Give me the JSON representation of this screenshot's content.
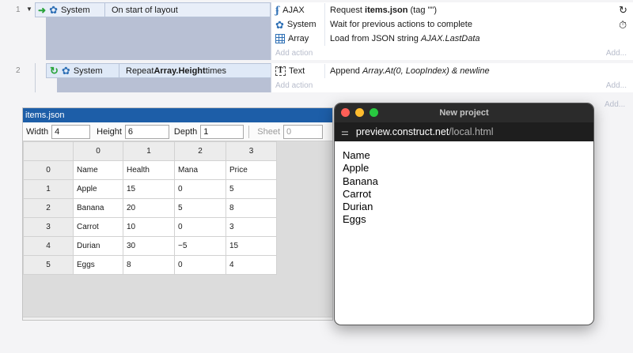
{
  "events": [
    {
      "number": "1",
      "condition": {
        "object": "System",
        "text": "On start of layout"
      },
      "actions": [
        {
          "object": "AJAX",
          "icon": "ajax-icon",
          "text_before": "Request ",
          "bold": "items.json",
          "text_after": " (tag \"\")",
          "italic": ""
        },
        {
          "object": "System",
          "icon": "gear-icon",
          "text_before": "Wait for previous actions to complete",
          "bold": "",
          "text_after": "",
          "italic": ""
        },
        {
          "object": "Array",
          "icon": "array-icon",
          "text_before": "Load from JSON string ",
          "bold": "",
          "text_after": "",
          "italic": "AJAX.LastData"
        }
      ],
      "add_action": "Add action",
      "add": "Add..."
    },
    {
      "number": "2",
      "condition": {
        "object": "System",
        "text_before": "Repeat ",
        "bold": "Array.Height",
        "text_after": " times"
      },
      "actions": [
        {
          "object": "Text",
          "icon": "text-icon",
          "text_before": "Append ",
          "italic": "Array.At(0, LoopIndex) & newline"
        }
      ],
      "add_action": "Add action",
      "add": "Add..."
    }
  ],
  "sheet_add": "Add...",
  "array_editor": {
    "title": "items.json",
    "width_label": "Width",
    "width_value": "4",
    "height_label": "Height",
    "height_value": "6",
    "depth_label": "Depth",
    "depth_value": "1",
    "sheet_label": "Sheet",
    "sheet_value": "0",
    "column_headers": [
      "0",
      "1",
      "2",
      "3"
    ],
    "rows": [
      {
        "index": "0",
        "cells": [
          "Name",
          "Health",
          "Mana",
          "Price"
        ]
      },
      {
        "index": "1",
        "cells": [
          "Apple",
          "15",
          "0",
          "5"
        ]
      },
      {
        "index": "2",
        "cells": [
          "Banana",
          "20",
          "5",
          "8"
        ]
      },
      {
        "index": "3",
        "cells": [
          "Carrot",
          "10",
          "0",
          "3"
        ]
      },
      {
        "index": "4",
        "cells": [
          "Durian",
          "30",
          "−5",
          "15"
        ]
      },
      {
        "index": "5",
        "cells": [
          "Eggs",
          "8",
          "0",
          "4"
        ]
      }
    ]
  },
  "browser": {
    "title": "New project",
    "url_host": "preview.construct.net",
    "url_path": "/local.html",
    "output_lines": [
      "Name",
      "Apple",
      "Banana",
      "Carrot",
      "Durian",
      "Eggs"
    ]
  },
  "colors": {
    "header_blue": "#1d5ea8",
    "traffic_red": "#ff5f57",
    "traffic_yellow": "#febc2e",
    "traffic_green": "#28c840"
  }
}
